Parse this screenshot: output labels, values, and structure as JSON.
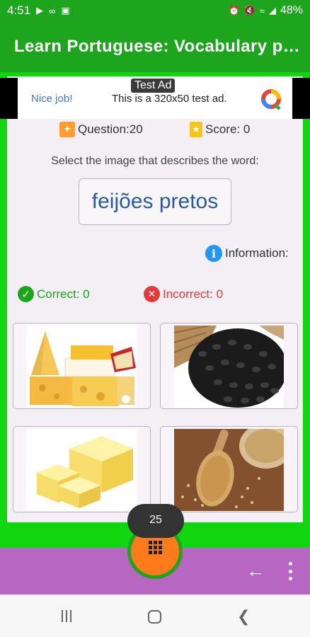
{
  "status": {
    "time": "4:51",
    "battery": "48%",
    "left_icons": [
      "play-store-icon",
      "voicemail-icon",
      "app-icon"
    ],
    "right_icons": [
      "alarm-icon",
      "mute-icon",
      "wifi-icon",
      "signal-icon"
    ]
  },
  "app_bar": {
    "title": "Learn Portuguese: Vocabulary par..."
  },
  "ad": {
    "tag": "Test Ad",
    "nice": "Nice job!",
    "text": "This is a 320x50 test ad."
  },
  "quiz": {
    "question_label": "Question:20",
    "score_label": "Score: 0",
    "instruction": "Select the image that describes the word:",
    "word": "feijões pretos",
    "information": "Information:",
    "correct": "Correct: 0",
    "incorrect": "Incorrect: 0",
    "options": [
      {
        "name": "option-cheese-assortment",
        "icon": "cheese-image"
      },
      {
        "name": "option-black-beans",
        "icon": "black-beans-image"
      },
      {
        "name": "option-butter",
        "icon": "butter-image"
      },
      {
        "name": "option-sesame-seeds",
        "icon": "sesame-image"
      }
    ]
  },
  "bottom": {
    "counter": "25"
  },
  "colors": {
    "primary_green": "#1ea51e",
    "frame_green": "#0fd60f",
    "bottom_purple": "#b766c1",
    "fab_orange": "#ff7a1a",
    "word_blue": "#2a59a6",
    "correct_green": "#1ea51e",
    "incorrect_red": "#e23a3a"
  }
}
